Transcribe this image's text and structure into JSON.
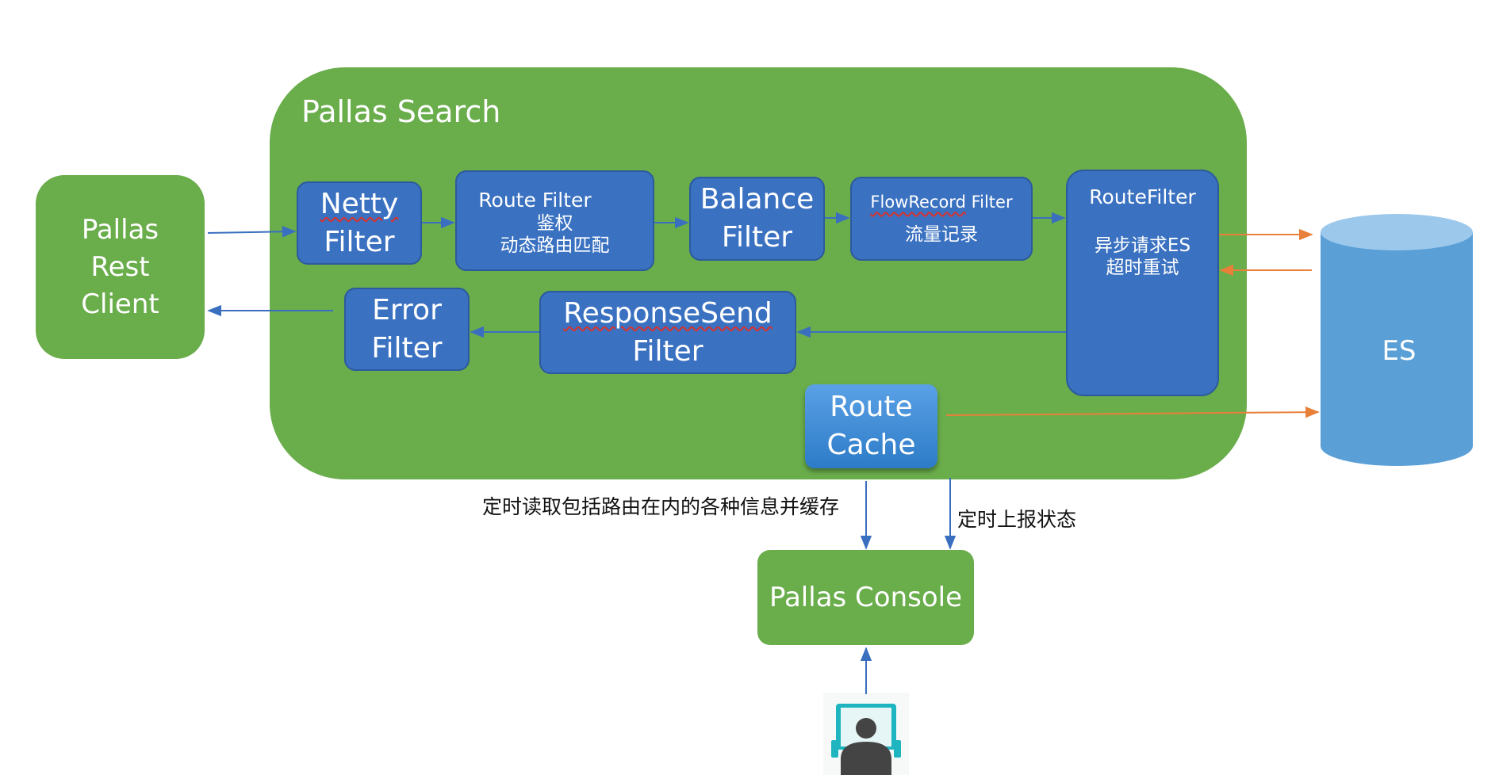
{
  "pallas_search": {
    "title": "Pallas Search"
  },
  "rest_client": {
    "line1": "Pallas",
    "line2": "Rest",
    "line3": "Client"
  },
  "netty_filter": {
    "line1": "Netty",
    "line2": "Filter"
  },
  "route_filter_auth": {
    "line1": "Route Filter",
    "line2": "鉴权",
    "line3": "动态路由匹配"
  },
  "balance_filter": {
    "line1": "Balance",
    "line2": "Filter"
  },
  "flowrecord_filter": {
    "line1_word": "FlowRecord",
    "line1_rest": " Filter",
    "line2": "流量记录"
  },
  "route_filter_async": {
    "line1": "RouteFilter",
    "line2": "异步请求ES",
    "line3": "超时重试"
  },
  "responsesend_filter": {
    "line1": "ResponseSend",
    "line2": "Filter"
  },
  "error_filter": {
    "line1": "Error",
    "line2": "Filter"
  },
  "route_cache": {
    "line1": "Route",
    "line2": "Cache"
  },
  "es": {
    "label": "ES"
  },
  "console": {
    "label": "Pallas Console"
  },
  "edge_labels": {
    "cache_read": "定时读取包括路由在内的各种信息并缓存",
    "status_report": "定时上报状态"
  },
  "colors": {
    "container_green": "#6aad4b",
    "filter_blue": "#3a71c1",
    "es_blue": "#5a9fd6",
    "arrow_blue": "#3a6fc0",
    "arrow_orange": "#e8803a"
  },
  "icons": {
    "user": "user-monitor-icon"
  }
}
